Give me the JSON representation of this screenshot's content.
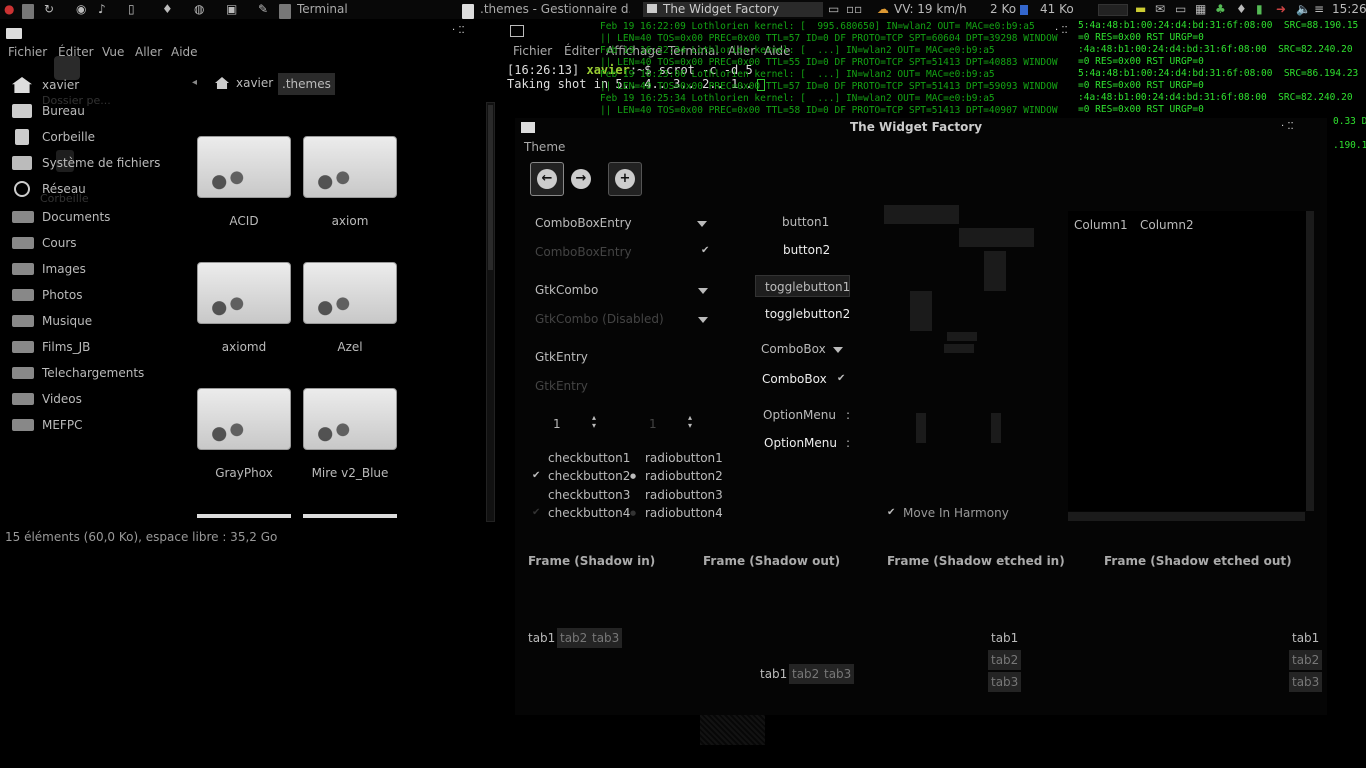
{
  "panel": {
    "terminal_task": "Terminal",
    "fm_task": ".themes - Gestionnaire d...",
    "wf_task": "The Widget Factory",
    "speed": "VV: 19 km/h",
    "net_down": "2 Ko",
    "net_up": "41 Ko",
    "clock": "15:26",
    "colors": {
      "bg": "#080808",
      "text": "#bbbbbb"
    }
  },
  "file_manager": {
    "menu": [
      "Fichier",
      "Éditer",
      "Vue",
      "Aller",
      "Aide"
    ],
    "breadcrumb": [
      "xavier",
      ".themes"
    ],
    "sidebar": [
      {
        "label": "xavier",
        "icon": "home-icon"
      },
      {
        "label": "Bureau",
        "icon": "desktop-icon"
      },
      {
        "label": "Corbeille",
        "icon": "trash-icon"
      },
      {
        "label": "Système de fichiers",
        "icon": "drive-icon"
      },
      {
        "label": "Réseau",
        "icon": "network-icon"
      },
      {
        "label": "Documents",
        "icon": "folder-icon"
      },
      {
        "label": "Cours",
        "icon": "folder-icon"
      },
      {
        "label": "Images",
        "icon": "folder-icon"
      },
      {
        "label": "Photos",
        "icon": "folder-icon"
      },
      {
        "label": "Musique",
        "icon": "folder-icon"
      },
      {
        "label": "Films_JB",
        "icon": "folder-icon"
      },
      {
        "label": "Telechargements",
        "icon": "folder-icon"
      },
      {
        "label": "Videos",
        "icon": "folder-icon"
      },
      {
        "label": "MEFPC",
        "icon": "folder-icon"
      }
    ],
    "desktop_ghost_labels": [
      "Dossier pe...",
      "Corbeille"
    ],
    "folders": [
      "ACID",
      "axiom",
      "axiomd",
      "Azel",
      "GrayPhox",
      "Mire v2_Blue"
    ],
    "status": "15 éléments (60,0 Ko), espace libre : 35,2 Go"
  },
  "terminal": {
    "menu": [
      "Fichier",
      "Éditer",
      "Affichage",
      "Terminal",
      "Aller",
      "Aide"
    ],
    "prompt_time": "[16:26:13]",
    "prompt_user": "xavier",
    "prompt_path": ":~$",
    "command": "scrot -c -d 5",
    "output": "Taking shot in 5.. 4.. 3.. 2.. 1..",
    "log_left": [
      "Feb 19 16:22:09 Lothlorien kernel: [  995.680650] IN=wlan2 OUT= MAC=e0:b9:a5",
      "|| LEN=40 TOS=0x00 PREC=0x00 TTL=57 ID=0 DF PROTO=TCP SPT=60604 DPT=39298 WINDOW",
      "Feb 19 16:22:34 Lothlorien kernel: [  ...] IN=wlan2 OUT= MAC=e0:b9:a5",
      "|| LEN=40 TOS=0x00 PREC=0x00 TTL=55 ID=0 DF PROTO=TCP SPT=51413 DPT=40883 WINDOW",
      "Feb 19 16:23:06 Lothlorien kernel: [  ...] IN=wlan2 OUT= MAC=e0:b9:a5",
      "|| LEN=40 TOS=0x00 PREC=0x00 TTL=57 ID=0 DF PROTO=TCP SPT=51413 DPT=59093 WINDOW",
      "Feb 19 16:25:34 Lothlorien kernel: [  ...] IN=wlan2 OUT= MAC=e0:b9:a5",
      "|| LEN=40 TOS=0x00 PREC=0x00 TTL=58 ID=0 DF PROTO=TCP SPT=51413 DPT=40907 WINDOW"
    ],
    "log_right": [
      "5:4a:48:b1:00:24:d4:bd:31:6f:08:00  SRC=88.190.15",
      "=0 RES=0x00 RST URGP=0",
      ":4a:48:b1:00:24:d4:bd:31:6f:08:00  SRC=82.240.20",
      "=0 RES=0x00 RST URGP=0",
      "5:4a:48:b1:00:24:d4:bd:31:6f:08:00  SRC=86.194.23",
      "=0 RES=0x00 RST URGP=0",
      ":4a:48:b1:00:24:d4:bd:31:6f:08:00  SRC=82.240.20",
      "=0 RES=0x00 RST URGP=0"
    ],
    "log_tail": [
      "0.33 D",
      ".190.15"
    ]
  },
  "widget_factory": {
    "title": "The Widget Factory",
    "theme_label": "Theme",
    "combo_entry": "ComboBoxEntry",
    "combo_entry_disabled": "ComboBoxEntry",
    "gtk_combo": "GtkCombo",
    "gtk_combo_disabled": "GtkCombo (Disabled)",
    "gtk_entry": "GtkEntry",
    "gtk_entry_disabled": "GtkEntry",
    "spin1": "1",
    "spin2": "1",
    "checks": [
      "checkbutton1",
      "checkbutton2",
      "checkbutton3",
      "checkbutton4"
    ],
    "radios": [
      "radiobutton1",
      "radiobutton2",
      "radiobutton3",
      "radiobutton4"
    ],
    "button1": "button1",
    "button2": "button2",
    "toggle1": "togglebutton1",
    "toggle2": "togglebutton2",
    "combobox1": "ComboBox",
    "combobox2": "ComboBox",
    "option1": "OptionMenu",
    "option2": "OptionMenu",
    "columns": [
      "Column1",
      "Column2"
    ],
    "harmony": "Move In Harmony",
    "frames": [
      "Frame (Shadow in)",
      "Frame (Shadow out)",
      "Frame (Shadow etched in)",
      "Frame (Shadow etched out)"
    ],
    "tabs": [
      "tab1",
      "tab2",
      "tab3"
    ],
    "check_mark": "✔",
    "radio_dot": "●"
  }
}
